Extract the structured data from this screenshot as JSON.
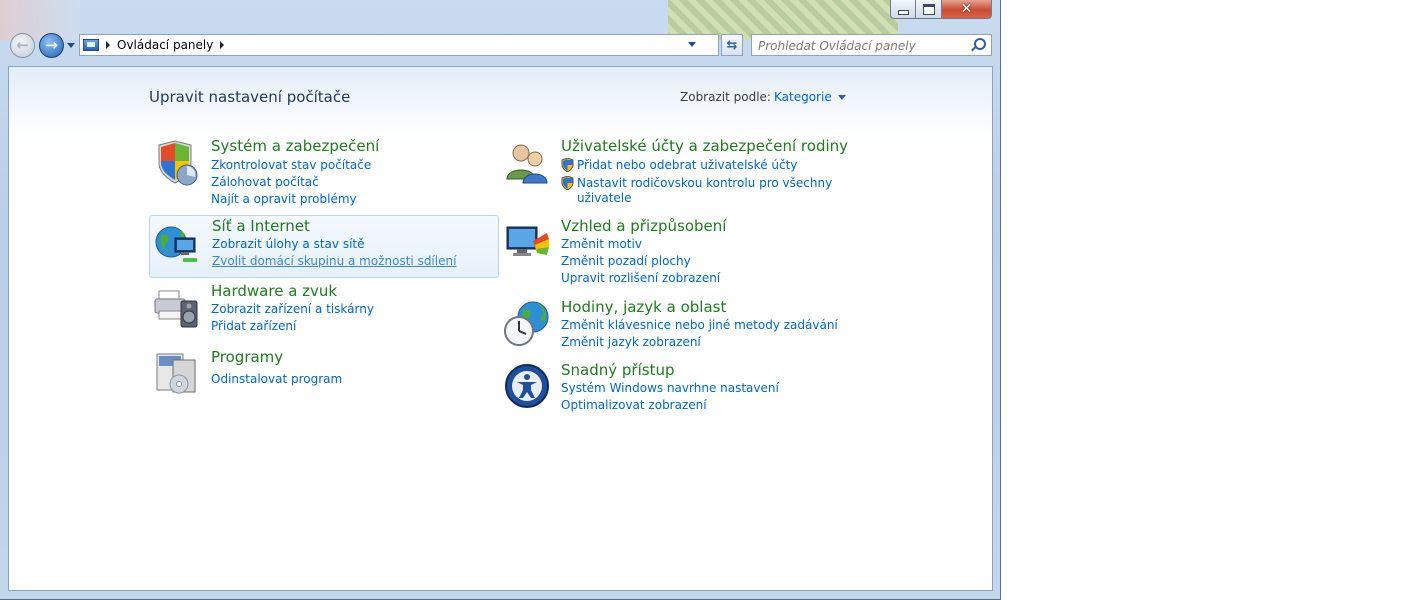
{
  "window": {
    "caption_buttons": [
      "minimize",
      "maximize",
      "close"
    ]
  },
  "navbar": {
    "breadcrumb": [
      "Ovládací panely"
    ],
    "search_placeholder": "Prohledat Ovládací panely"
  },
  "header": {
    "title": "Upravit nastavení počítače",
    "view_by_label": "Zobrazit podle:",
    "view_by_value": "Kategorie"
  },
  "categories": {
    "system": {
      "title": "Systém a zabezpečení",
      "links": [
        "Zkontrolovat stav počítače",
        "Zálohovat počítač",
        "Najít a opravit problémy"
      ]
    },
    "network": {
      "title": "Síť a Internet",
      "links": [
        "Zobrazit úlohy a stav sítě",
        "Zvolit domácí skupinu a možnosti sdílení"
      ]
    },
    "hardware": {
      "title": "Hardware a zvuk",
      "links": [
        "Zobrazit zařízení a tiskárny",
        "Přidat zařízení"
      ]
    },
    "programs": {
      "title": "Programy",
      "links": [
        "Odinstalovat program"
      ]
    },
    "users": {
      "title": "Uživatelské účty a zabezpečení rodiny",
      "links": [
        "Přidat nebo odebrat uživatelské účty",
        "Nastavit rodičovskou kontrolu pro všechny uživatele"
      ]
    },
    "appearance": {
      "title": "Vzhled a přizpůsobení",
      "links": [
        "Změnit motiv",
        "Změnit pozadí plochy",
        "Upravit rozlišení zobrazení"
      ]
    },
    "clock": {
      "title": "Hodiny, jazyk a oblast",
      "links": [
        "Změnit klávesnice nebo jiné metody zadávání",
        "Změnit jazyk zobrazení"
      ]
    },
    "ease": {
      "title": "Snadný přístup",
      "links": [
        "Systém Windows navrhne nastavení",
        "Optimalizovat zobrazení"
      ]
    }
  },
  "colors": {
    "category_title": "#1f7b1f",
    "link": "#0066cc",
    "page_title": "#1e395b"
  }
}
